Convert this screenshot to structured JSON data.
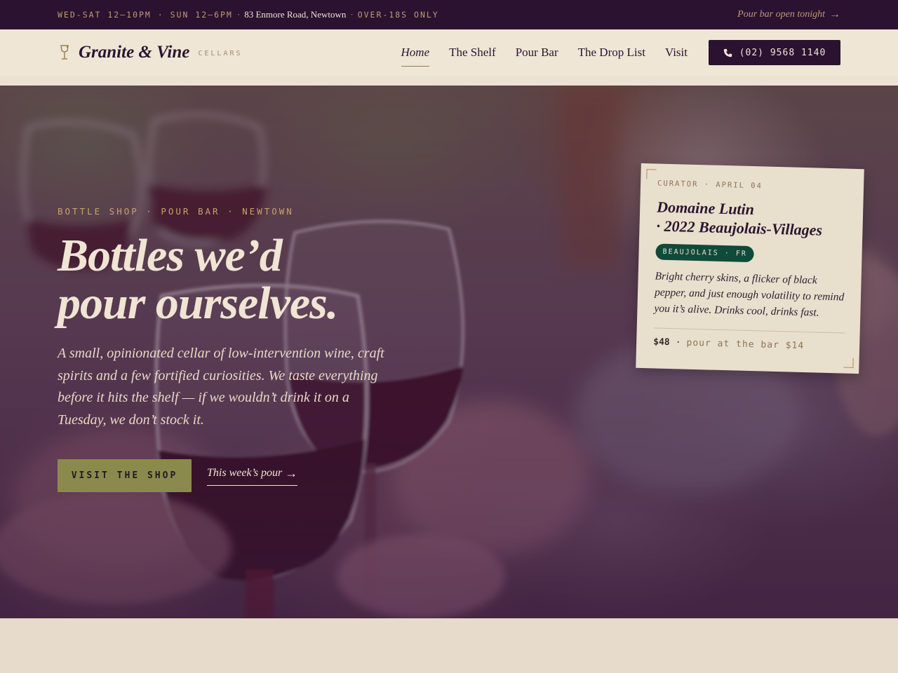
{
  "topbar": {
    "hours": "WED-SAT 12–10PM · SUN 12–6PM",
    "separator": "·",
    "address": "83 Enmore Road, Newtown",
    "age": "OVER-18S ONLY",
    "cta": "Pour bar open tonight",
    "cta_arrow": "→"
  },
  "header": {
    "brand_name": "Granite & Vine",
    "brand_sub": "CELLARS",
    "logo_icon": "wine-glass-icon",
    "nav": [
      {
        "label": "Home",
        "active": true
      },
      {
        "label": "The Shelf",
        "active": false
      },
      {
        "label": "Pour Bar",
        "active": false
      },
      {
        "label": "The Drop List",
        "active": false
      },
      {
        "label": "Visit",
        "active": false
      }
    ],
    "phone": "(02) 9568 1140",
    "phone_icon": "phone-icon"
  },
  "hero": {
    "eyebrow": "BOTTLE SHOP · POUR BAR · NEWTOWN",
    "title_line1": "Bottles we’d",
    "title_line2": "pour ourselves.",
    "description": "A small, opinionated cellar of low-intervention wine, craft spirits and a few fortified curiosities. We taste everything before it hits the shelf — if we wouldn’t drink it on a Tuesday, we don’t stock it.",
    "primary_button": "VISIT THE SHOP",
    "secondary_link": "This week’s pour",
    "secondary_arrow": "→"
  },
  "curator_card": {
    "meta": "CURATOR · APRIL 04",
    "wine_line1": "Domaine Lutin",
    "wine_line2": "· 2022 Beaujolais-Villages",
    "tag": "BEAUJOLAIS · FR",
    "notes": "Bright cherry skins, a flicker of black pepper, and just enough volatility to remind you it’s alive. Drinks cool, drinks fast.",
    "price": "$48",
    "separator": "·",
    "pour_price": "pour at the bar $14"
  },
  "colors": {
    "aubergine": "#2a1230",
    "cream": "#efe6d6",
    "gold": "#c9a268",
    "olive": "#8a8a4c",
    "bottle_green": "#0f4a3a"
  }
}
